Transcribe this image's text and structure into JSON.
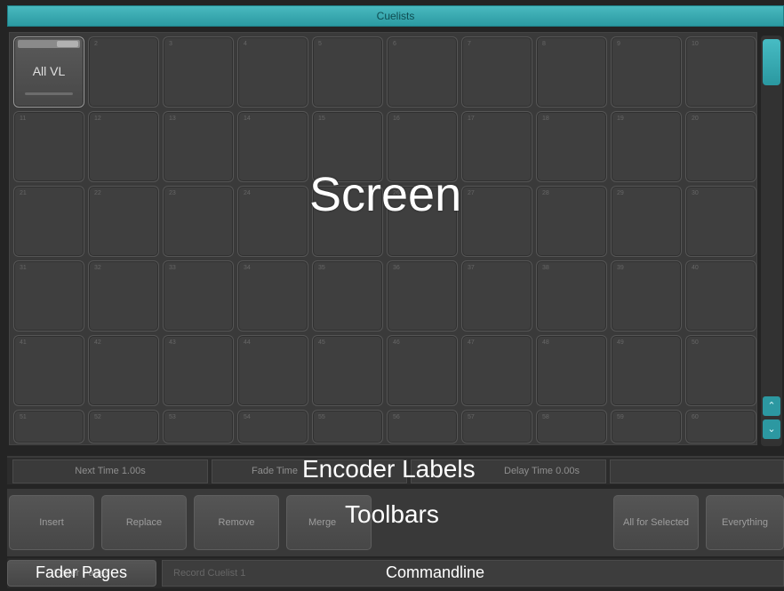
{
  "window": {
    "title": "Cuelists"
  },
  "grid": {
    "active_cell": {
      "number": "1",
      "label": "All VL"
    },
    "cell_numbers": [
      "1",
      "2",
      "3",
      "4",
      "5",
      "6",
      "7",
      "8",
      "9",
      "10",
      "11",
      "12",
      "13",
      "14",
      "15",
      "16",
      "17",
      "18",
      "19",
      "20",
      "21",
      "22",
      "23",
      "24",
      "25",
      "26",
      "27",
      "28",
      "29",
      "30",
      "31",
      "32",
      "33",
      "34",
      "35",
      "36",
      "37",
      "38",
      "39",
      "40",
      "41",
      "42",
      "43",
      "44",
      "45",
      "46",
      "47",
      "48",
      "49",
      "50",
      "51",
      "52",
      "53",
      "54",
      "55",
      "56",
      "57",
      "58",
      "59",
      "60"
    ]
  },
  "scroll": {
    "up_icon": "chevron-up-icon",
    "down_icon": "chevron-down-icon"
  },
  "encoders": {
    "next_time": "Next Time 1.00s",
    "fade_time": "Fade Time",
    "delay_time": "Delay Time 0.00s"
  },
  "toolbar": {
    "insert": "Insert",
    "replace": "Replace",
    "remove": "Remove",
    "merge": "Merge",
    "all_for_selected": "All for Selected",
    "everything": "Everything"
  },
  "bottom": {
    "fader_pages": "Fader Pages",
    "commandline": "Record Cuelist 1"
  },
  "annotations": {
    "screen": "Screen",
    "encoder_labels": "Encoder Labels",
    "toolbars": "Toolbars",
    "fader_pages": "Fader Pages",
    "commandline": "Commandline"
  },
  "colors": {
    "accent": "#2f9ea6",
    "background": "#242424",
    "cell": "#3f3f3f"
  }
}
